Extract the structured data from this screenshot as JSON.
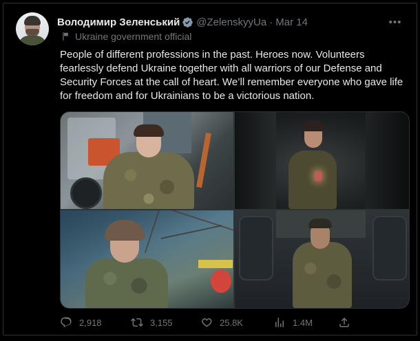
{
  "author": {
    "display_name": "Володимир Зеленський",
    "handle": "@ZelenskyyUa",
    "separator": "·",
    "date": "Mar 14",
    "affiliation": "Ukraine government official",
    "verified_color": "#829aab"
  },
  "tweet": {
    "text": "People of different professions in the past. Heroes now. Volunteers fearlessly defend Ukraine together with all warriors of our Defense and Security Forces at the call of heart. We’ll remember everyone who gave life for freedom and for Ukrainians to be a victorious nation."
  },
  "media": {
    "photo_count": 4
  },
  "actions": {
    "replies": "2,918",
    "retweets": "3,155",
    "likes": "25.8K",
    "views": "1.4M"
  },
  "icons": [
    "verified-badge-icon",
    "flag-icon",
    "more-icon",
    "reply-icon",
    "retweet-icon",
    "like-icon",
    "views-icon",
    "share-icon"
  ],
  "colors": {
    "background": "#000000",
    "text_primary": "#e7e9ea",
    "text_secondary": "#71767b",
    "border": "#2f3336"
  }
}
